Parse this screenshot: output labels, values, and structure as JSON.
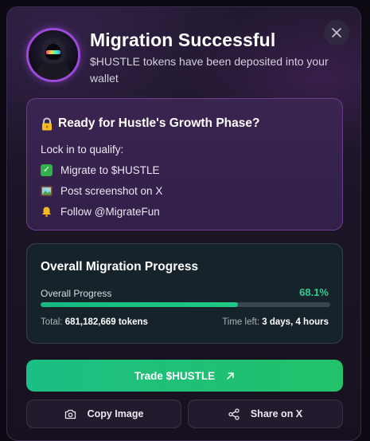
{
  "header": {
    "title": "Migration Successful",
    "subtitle": "$HUSTLE tokens have been deposited into your wallet"
  },
  "growth": {
    "icon": "lock-icon",
    "title": "Ready for Hustle's Growth Phase?",
    "lead": "Lock in to qualify:",
    "tasks": [
      {
        "icon": "check-box-icon",
        "label": "Migrate to $HUSTLE"
      },
      {
        "icon": "picture-icon",
        "label": "Post screenshot on X"
      },
      {
        "icon": "bell-icon",
        "label": "Follow @MigrateFun"
      }
    ]
  },
  "progress": {
    "title": "Overall Migration Progress",
    "label": "Overall Progress",
    "percent_text": "68.1%",
    "fraction": 0.681,
    "total_label": "Total:",
    "total_value": "681,182,669 tokens",
    "time_label": "Time left:",
    "time_value": "3 days, 4 hours"
  },
  "actions": {
    "trade_label": "Trade $HUSTLE",
    "copy_label": "Copy Image",
    "share_label": "Share on X"
  },
  "colors": {
    "accent_green": "#22c985",
    "avatar_ring": "#9d4ad9",
    "card_purple": "#3a2550",
    "card_dark": "#17232a"
  }
}
